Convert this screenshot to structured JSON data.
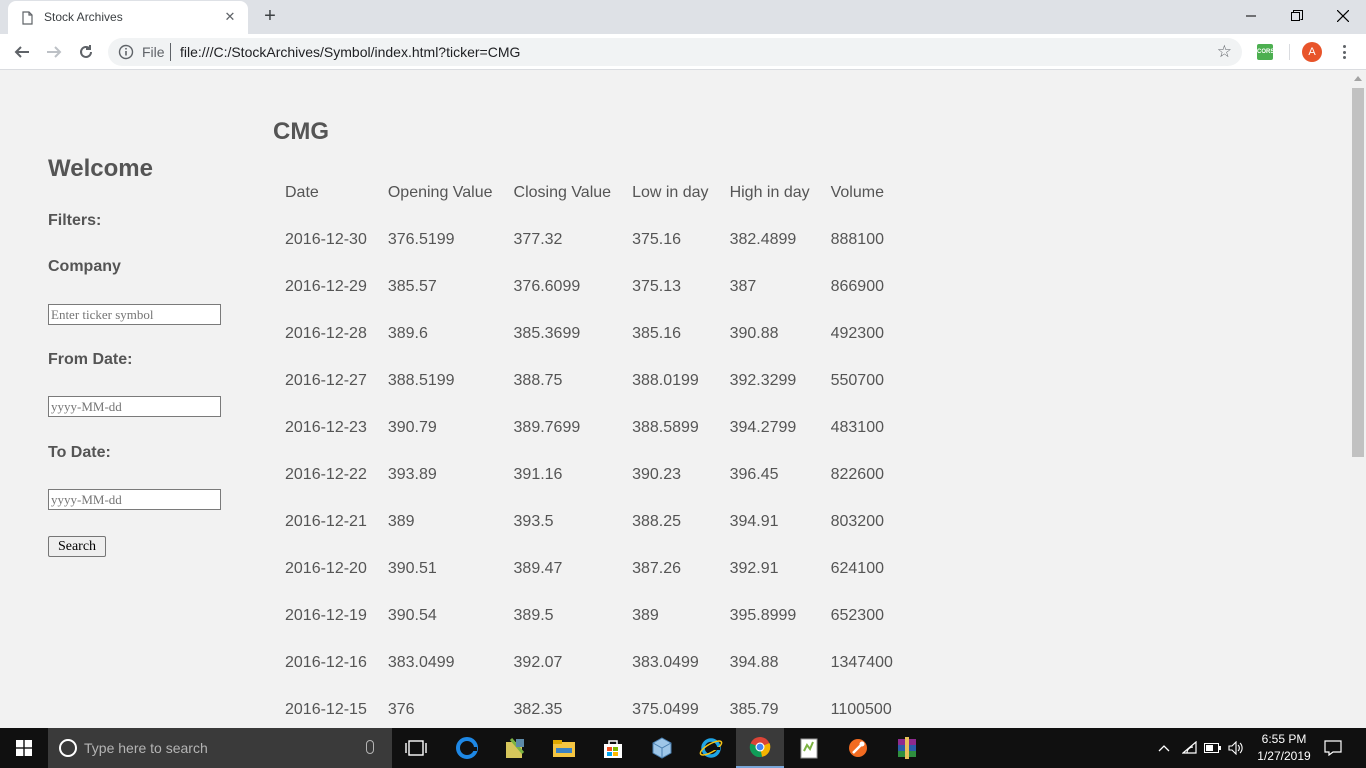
{
  "browser": {
    "tab_title": "Stock Archives",
    "url_scheme": "File",
    "url": "file:///C:/StockArchives/Symbol/index.html?ticker=CMG",
    "profile_initial": "A",
    "extension_label": "CORS"
  },
  "sidebar": {
    "welcome": "Welcome",
    "filters_label": "Filters:",
    "company_label": "Company",
    "company_placeholder": "Enter ticker symbol",
    "from_label": "From Date:",
    "from_placeholder": "yyyy-MM-dd",
    "to_label": "To Date:",
    "to_placeholder": "yyyy-MM-dd",
    "search_label": "Search"
  },
  "main": {
    "ticker": "CMG",
    "columns": [
      "Date",
      "Opening Value",
      "Closing Value",
      "Low in day",
      "High in day",
      "Volume"
    ],
    "rows": [
      [
        "2016-12-30",
        "376.5199",
        "377.32",
        "375.16",
        "382.4899",
        "888100"
      ],
      [
        "2016-12-29",
        "385.57",
        "376.6099",
        "375.13",
        "387",
        "866900"
      ],
      [
        "2016-12-28",
        "389.6",
        "385.3699",
        "385.16",
        "390.88",
        "492300"
      ],
      [
        "2016-12-27",
        "388.5199",
        "388.75",
        "388.0199",
        "392.3299",
        "550700"
      ],
      [
        "2016-12-23",
        "390.79",
        "389.7699",
        "388.5899",
        "394.2799",
        "483100"
      ],
      [
        "2016-12-22",
        "393.89",
        "391.16",
        "390.23",
        "396.45",
        "822600"
      ],
      [
        "2016-12-21",
        "389",
        "393.5",
        "388.25",
        "394.91",
        "803200"
      ],
      [
        "2016-12-20",
        "390.51",
        "389.47",
        "387.26",
        "392.91",
        "624100"
      ],
      [
        "2016-12-19",
        "390.54",
        "389.5",
        "389",
        "395.8999",
        "652300"
      ],
      [
        "2016-12-16",
        "383.0499",
        "392.07",
        "383.0499",
        "394.88",
        "1347400"
      ],
      [
        "2016-12-15",
        "376",
        "382.35",
        "375.0499",
        "385.79",
        "1100500"
      ]
    ]
  },
  "taskbar": {
    "search_placeholder": "Type here to search",
    "time": "6:55 PM",
    "date": "1/27/2019"
  }
}
